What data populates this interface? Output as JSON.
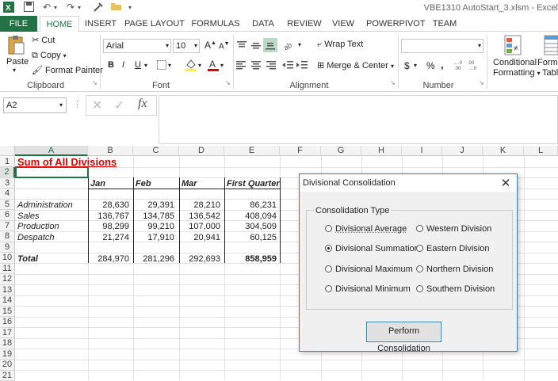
{
  "window": {
    "title": "VBE1310 AutoStart_3.xlsm - Excel"
  },
  "tabs": [
    "FILE",
    "HOME",
    "INSERT",
    "PAGE LAYOUT",
    "FORMULAS",
    "DATA",
    "REVIEW",
    "VIEW",
    "POWERPIVOT",
    "TEAM"
  ],
  "ribbon": {
    "clipboard": {
      "paste": "Paste",
      "cut": "Cut",
      "copy": "Copy",
      "format_painter": "Format Painter",
      "label": "Clipboard"
    },
    "font": {
      "name": "Arial",
      "size": "10",
      "label": "Font",
      "bold": "B",
      "italic": "I",
      "underline": "U",
      "grow": "A",
      "shrink": "A"
    },
    "alignment": {
      "wrap_text": "Wrap Text",
      "merge_center": "Merge & Center",
      "label": "Alignment"
    },
    "number": {
      "currency": "$",
      "percent": "%",
      "comma": ",",
      "label": "Number"
    },
    "styles": {
      "conditional": "Conditional",
      "formatting": "Formatting",
      "format_as": "Forma",
      "table": "Table"
    }
  },
  "formula_bar": {
    "name_box": "A2",
    "fx": "fx",
    "value": ""
  },
  "columns": [
    "A",
    "B",
    "C",
    "D",
    "E",
    "F",
    "G",
    "H",
    "I",
    "J",
    "K",
    "L"
  ],
  "rows": [
    "1",
    "2",
    "3",
    "4",
    "5",
    "6",
    "7",
    "8",
    "9",
    "10",
    "11",
    "12",
    "13",
    "14",
    "15",
    "16",
    "17",
    "18",
    "19",
    "20",
    "21"
  ],
  "sheet": {
    "title": "Sum of All Divisions",
    "headers": [
      "Jan",
      "Feb",
      "Mar",
      "First Quarter"
    ],
    "data": [
      {
        "label": "Administration",
        "jan": "28,630",
        "feb": "29,391",
        "mar": "28,210",
        "q1": "86,231"
      },
      {
        "label": "Sales",
        "jan": "136,767",
        "feb": "134,785",
        "mar": "136,542",
        "q1": "408,094"
      },
      {
        "label": "Production",
        "jan": "98,299",
        "feb": "99,210",
        "mar": "107,000",
        "q1": "304,509"
      },
      {
        "label": "Despatch",
        "jan": "21,274",
        "feb": "17,910",
        "mar": "20,941",
        "q1": "60,125"
      }
    ],
    "total": {
      "label": "Total",
      "jan": "284,970",
      "feb": "281,296",
      "mar": "292,693",
      "q1": "858,959"
    }
  },
  "dialog": {
    "title": "Divisional Consolidation",
    "group": "Consolidation Type",
    "options": [
      {
        "label": "Divisional Average",
        "selected": false
      },
      {
        "label": "Western Division",
        "selected": false
      },
      {
        "label": "Divisional Summation",
        "selected": true
      },
      {
        "label": "Eastern Division",
        "selected": false
      },
      {
        "label": "Divisional Maximum",
        "selected": false
      },
      {
        "label": "Northern Division",
        "selected": false
      },
      {
        "label": "Divisional Minimum",
        "selected": false
      },
      {
        "label": "Southern Division",
        "selected": false
      }
    ],
    "button": "Perform Consolidation",
    "close": "✕"
  },
  "colors": {
    "accent": "#217346",
    "title_red": "#e00000",
    "dialog_border": "#3c7fb1"
  }
}
